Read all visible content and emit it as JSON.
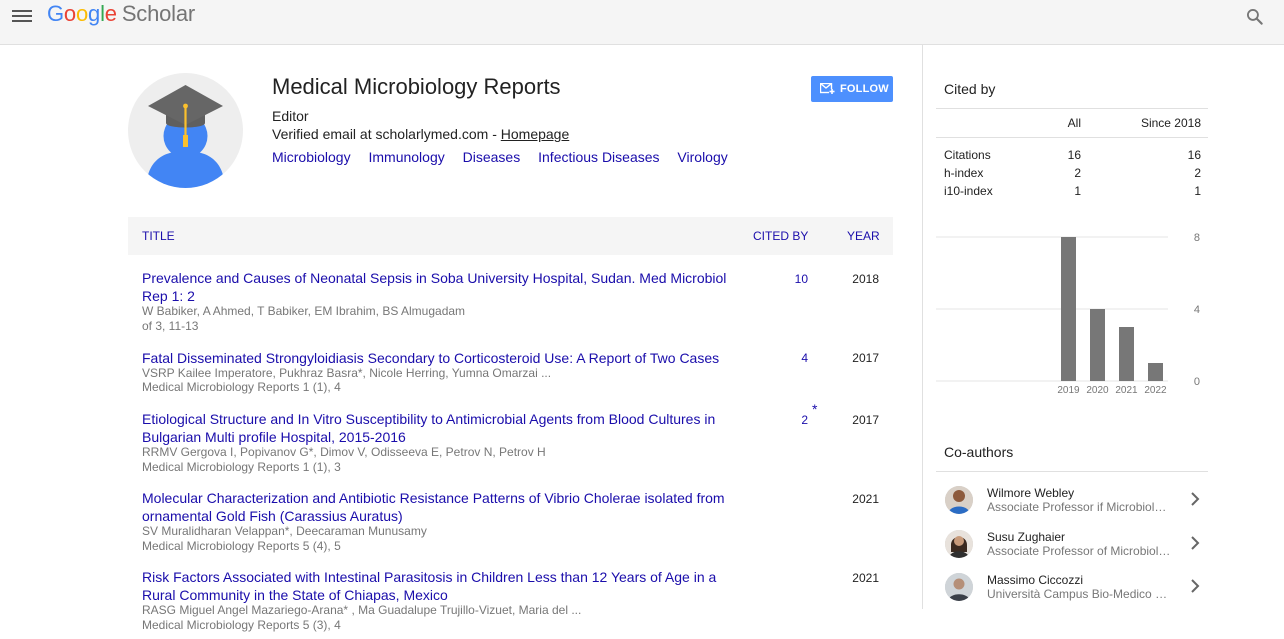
{
  "header": {
    "logo_letters": [
      "G",
      "o",
      "o",
      "g",
      "l",
      "e"
    ],
    "logo_product": "Scholar"
  },
  "profile": {
    "name": "Medical Microbiology Reports",
    "affiliation": "Editor",
    "email_text": "Verified email at scholarlymed.com - ",
    "homepage_label": "Homepage",
    "interests": [
      "Microbiology",
      "Immunology",
      "Diseases",
      "Infectious Diseases",
      "Virology"
    ],
    "follow_label": "FOLLOW"
  },
  "table": {
    "headers": {
      "title": "TITLE",
      "cited_by": "CITED BY",
      "year": "YEAR"
    },
    "rows": [
      {
        "title": "Prevalence and Causes of Neonatal Sepsis in Soba University Hospital, Sudan. Med Microbiol Rep 1: 2",
        "authors": "W Babiker, A Ahmed, T Babiker, EM Ibrahim, BS Almugadam",
        "venue": "of 3, 11-13",
        "cited": "10",
        "star": "",
        "year": "2018"
      },
      {
        "title": "Fatal Disseminated Strongyloidiasis Secondary to Corticosteroid Use: A Report of Two Cases",
        "authors": "VSRP Kailee Imperatore, Pukhraz Basra*, Nicole Herring, Yumna Omarzai ...",
        "venue": "Medical Microbiology Reports 1 (1), 4",
        "cited": "4",
        "star": "",
        "year": "2017"
      },
      {
        "title": "Etiological Structure and In Vitro Susceptibility to Antimicrobial Agents from Blood Cultures in Bulgarian Multi profile Hospital, 2015-2016",
        "authors": "RRMV Gergova I, Popivanov G*, Dimov V, Odisseeva E, Petrov N, Petrov H",
        "venue": "Medical Microbiology Reports 1 (1), 3",
        "cited": "2",
        "star": "*",
        "year": "2017"
      },
      {
        "title": "Molecular Characterization and Antibiotic Resistance Patterns of Vibrio Cholerae isolated from ornamental Gold Fish (Carassius Auratus)",
        "authors": "SV Muralidharan Velappan*, Deecaraman Munusamy",
        "venue": "Medical Microbiology Reports 5 (4), 5",
        "cited": "",
        "star": "",
        "year": "2021"
      },
      {
        "title": "Risk Factors Associated with Intestinal Parasitosis in Children Less than 12 Years of Age in a Rural Community in the State of Chiapas, Mexico",
        "authors": "RASG Miguel Angel Mazariego-Arana* , Ma Guadalupe Trujillo-Vizuet, Maria del ...",
        "venue": "Medical Microbiology Reports 5 (3), 4",
        "cited": "",
        "star": "",
        "year": "2021"
      }
    ]
  },
  "cited_by": {
    "title": "Cited by",
    "col_all": "All",
    "col_since": "Since 2018",
    "rows": [
      {
        "label": "Citations",
        "all": "16",
        "since": "16"
      },
      {
        "label": "h-index",
        "all": "2",
        "since": "2"
      },
      {
        "label": "i10-index",
        "all": "1",
        "since": "1"
      }
    ]
  },
  "chart_data": {
    "type": "bar",
    "categories": [
      "2019",
      "2020",
      "2021",
      "2022"
    ],
    "values": [
      8,
      4,
      3,
      1
    ],
    "ylim": [
      0,
      8
    ],
    "yticks": [
      "8",
      "4",
      "0"
    ],
    "title": "",
    "xlabel": "",
    "ylabel": "",
    "grid": true,
    "bar_color": "#777777"
  },
  "coauthors": {
    "title": "Co-authors",
    "items": [
      {
        "name": "Wilmore Webley",
        "desc": "Associate Professor if Microbiology"
      },
      {
        "name": "Susu Zughaier",
        "desc": "Associate Professor of Microbiology"
      },
      {
        "name": "Massimo Ciccozzi",
        "desc": "Università Campus Bio-Medico di Roma"
      }
    ]
  },
  "colors": {
    "link": "#1a0dab",
    "follow_button": "#4d90fe",
    "avatar_blue": "#4285f4",
    "cap_gray": "#666666",
    "tassel": "#fbc02d"
  },
  "icons": {
    "menu": "hamburger-menu-icon",
    "search": "search-icon",
    "follow": "envelope-plus-icon",
    "coauthor_open": "chevron-right-icon"
  }
}
